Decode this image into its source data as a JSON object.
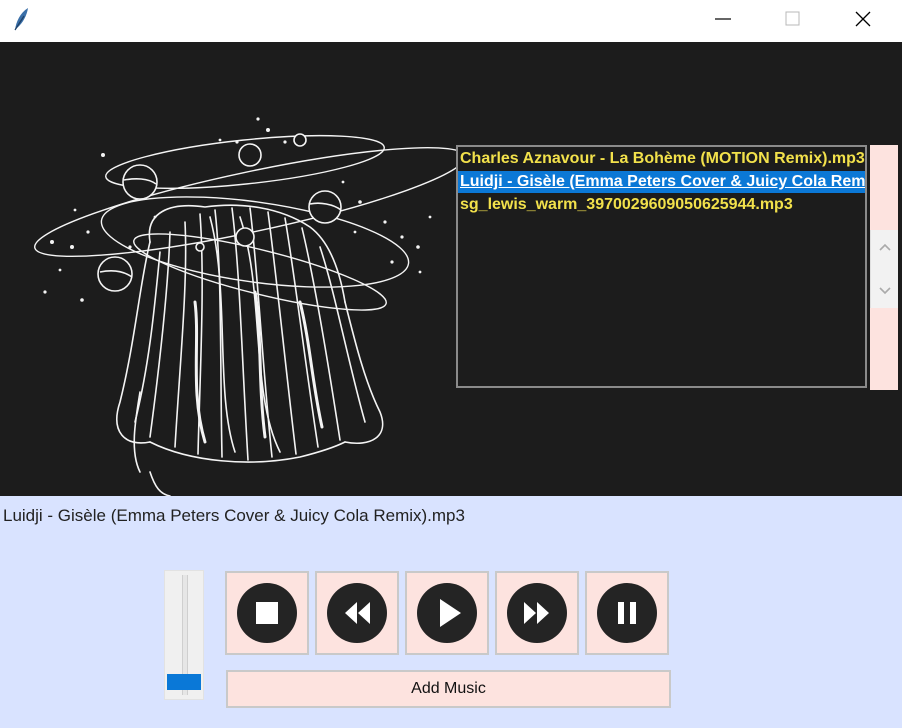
{
  "window": {
    "icon": "feather-icon"
  },
  "playlist": {
    "tracks": [
      "Charles Aznavour - La Bohème (MOTION Remix).mp3",
      "Luidji - Gisèle (Emma Peters Cover & Juicy Cola Remix).mp3",
      "sg_lewis_warm_3970029609050625944.mp3"
    ],
    "selected_index": 1
  },
  "now_playing": "Luidji - Gisèle (Emma Peters Cover & Juicy Cola Remix).mp3",
  "volume": {
    "level": 0.05
  },
  "controls": {
    "stop": "stop-icon",
    "rewind": "rewind-icon",
    "play": "play-icon",
    "fast_forward": "fast-forward-icon",
    "pause": "pause-icon",
    "add_music_label": "Add Music"
  },
  "colors": {
    "accent": "#0b78d6",
    "track_text": "#f2e14b",
    "button_bg": "#fde3df",
    "panel_bg": "#d9e3ff",
    "art_bg": "#1c1c1c"
  }
}
